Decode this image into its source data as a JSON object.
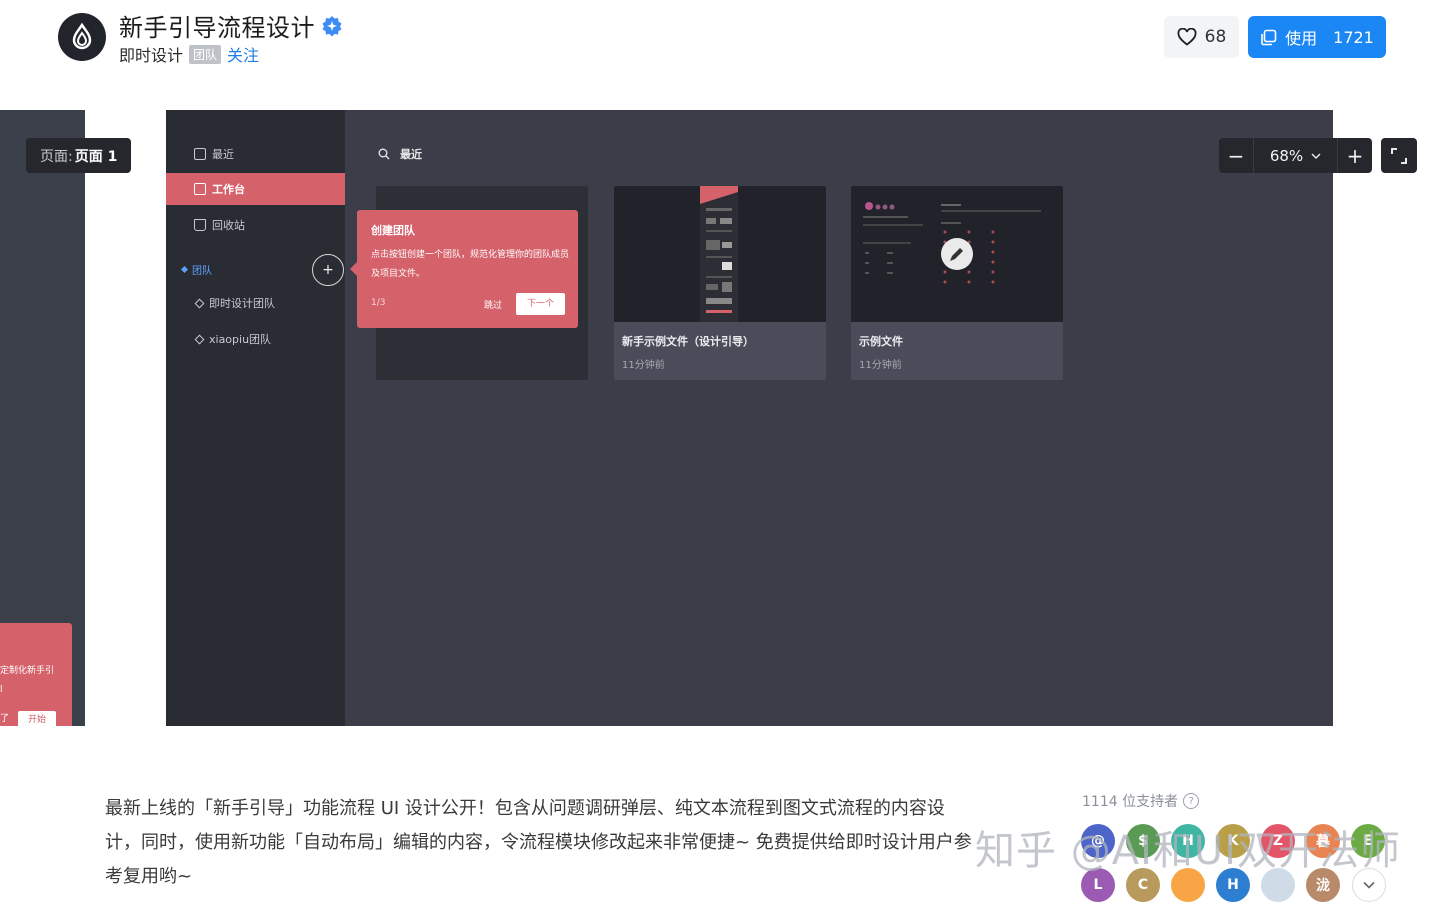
{
  "header": {
    "title": "新手引导流程设计",
    "author": "即时设计",
    "team_tag": "团队",
    "follow": "关注",
    "likes": "68",
    "use_label": "使用",
    "use_count": "1721"
  },
  "canvas": {
    "page_label": "页面:",
    "page_name": "页面 1",
    "zoom": "68%",
    "left_popup": {
      "text": "定制化新手引",
      "text2": "l",
      "button": "开始",
      "partial": "了"
    }
  },
  "sidebar": {
    "items": [
      {
        "label": "最近"
      },
      {
        "label": "工作台"
      },
      {
        "label": "回收站"
      }
    ],
    "team_header": "团队",
    "teams": [
      {
        "label": "即时设计团队"
      },
      {
        "label": "xiaopiu团队"
      }
    ]
  },
  "main": {
    "search_label": "最近",
    "tooltip": {
      "title": "创建团队",
      "body": "点击按钮创建一个团队，规范化管理你的团队成员及项目文件。",
      "step": "1/3",
      "skip": "跳过",
      "next": "下一个"
    },
    "files": [
      {
        "name": "新手示例文件（设计引导）",
        "time": "11分钟前"
      },
      {
        "name": "示例文件",
        "time": "11分钟前"
      }
    ]
  },
  "description": {
    "text": "最新上线的「新手引导」功能流程 UI 设计公开！包含从问题调研弹层、纯文本流程到图文式流程的内容设计，同时，使用新功能「自动布局」编辑的内容，令流程模块修改起来非常便捷~ 免费提供给即时设计用户参考复用哟~"
  },
  "supporters": {
    "label": "1114 位支持者",
    "row1": [
      {
        "letter": "@",
        "color": "#4d64c8"
      },
      {
        "letter": "$",
        "color": "#5b9a54"
      },
      {
        "letter": "H",
        "color": "#3fb5a3"
      },
      {
        "letter": "K",
        "color": "#b9a048"
      },
      {
        "letter": "Z",
        "color": "#e3566a"
      },
      {
        "letter": "暮",
        "color": "#e88452"
      },
      {
        "letter": "E",
        "color": "#6cab43"
      }
    ],
    "row2": [
      {
        "letter": "L",
        "color": "#9b5bb2"
      },
      {
        "letter": "C",
        "color": "#b89a5c"
      },
      {
        "letter": "",
        "color": "#f7a545"
      },
      {
        "letter": "H",
        "color": "#2d7ed0"
      },
      {
        "letter": "",
        "color": "#cfdbe6"
      },
      {
        "letter": "泷",
        "color": "#b88a6a"
      }
    ]
  },
  "watermark": "知乎 @AI和UI双开法师",
  "colors": {
    "accent": "#d5616a",
    "primary": "#1b87f5",
    "canvas": "#3b3e48",
    "sidebar": "#2a2c33"
  }
}
